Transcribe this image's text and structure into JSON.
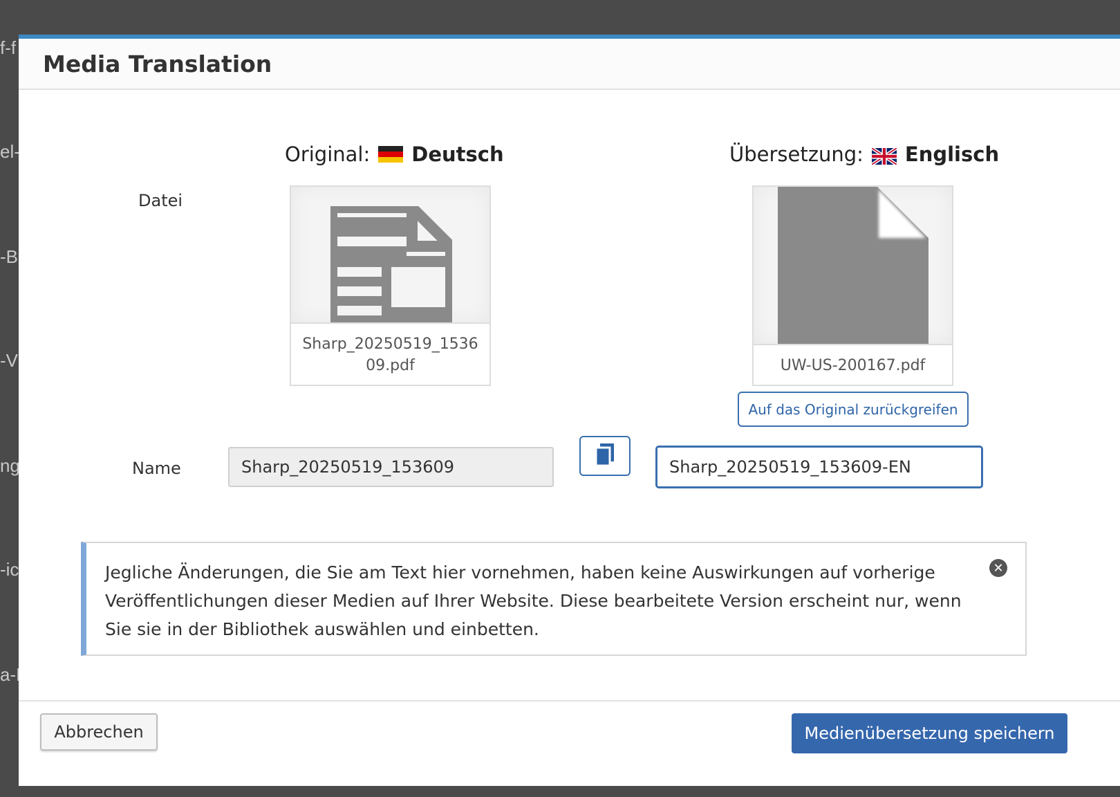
{
  "background": {
    "fragments": [
      "f-f",
      "el-(",
      "-B",
      "-V",
      "ng",
      "-ic",
      "a-N"
    ]
  },
  "modal": {
    "title": "Media Translation"
  },
  "original": {
    "prefix": "Original:",
    "language": "Deutsch",
    "flag_icon": "germany-flag-icon",
    "file_name": "Sharp_20250519_153609.pdf",
    "name_value": "Sharp_20250519_153609"
  },
  "translation": {
    "prefix": "Übersetzung:",
    "language": "Englisch",
    "flag_icon": "uk-flag-icon",
    "file_name": "UW-US-200167.pdf",
    "revert_label": "Auf das Original zurückgreifen",
    "name_value": "Sharp_20250519_153609-EN"
  },
  "labels": {
    "file": "Datei",
    "name": "Name"
  },
  "copy_button_icon": "copy-icon",
  "notice": {
    "text": "Jegliche Änderungen, die Sie am Text hier vornehmen, haben keine Auswirkungen auf vorherige Veröffentlichungen dieser Medien auf Ihrer Website. Diese bearbeitete Version erscheint nur, wenn Sie sie in der Bibliothek auswählen und einbetten.",
    "close_glyph": "✕"
  },
  "footer": {
    "cancel_label": "Abbrechen",
    "save_label": "Medienübersetzung speichern"
  },
  "colors": {
    "accent": "#3567ad",
    "modal_top_border": "#3b8ac4",
    "notice_border": "#7fa8d8"
  }
}
